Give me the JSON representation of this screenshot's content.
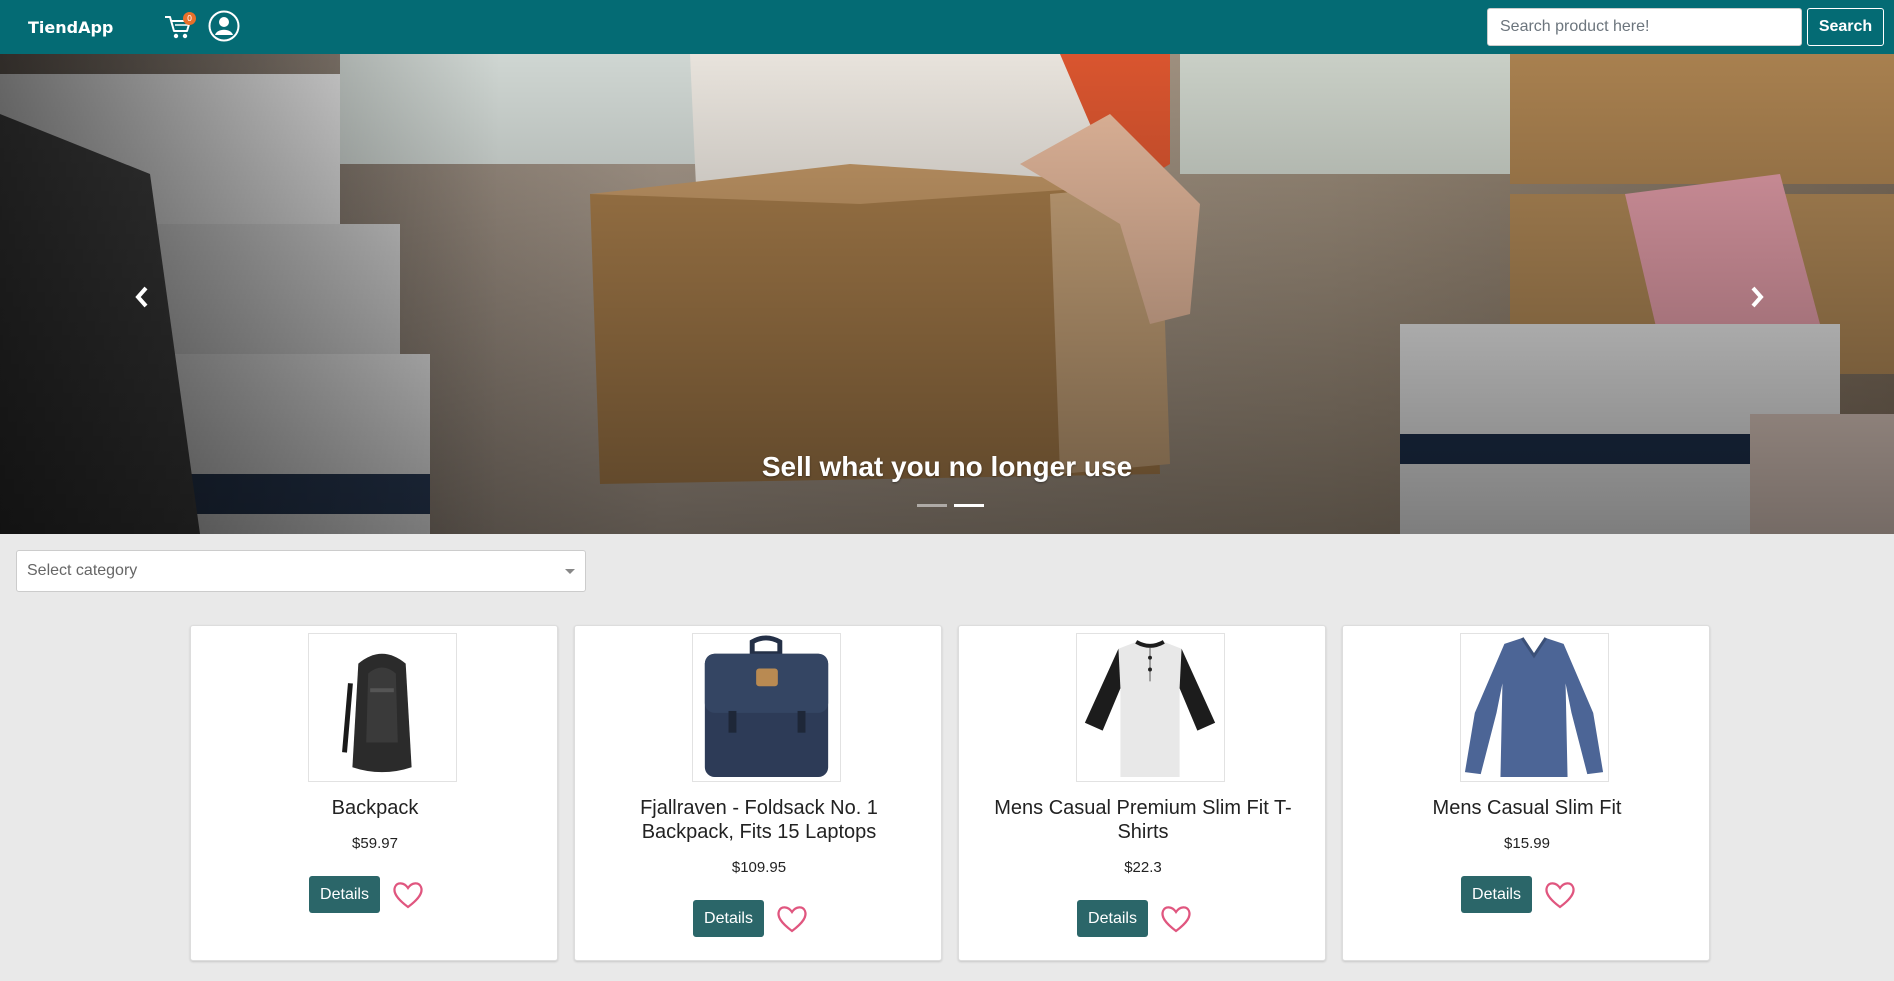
{
  "navbar": {
    "brand": "TiendApp",
    "cart_count": "0",
    "search_placeholder": "Search product here!",
    "search_button": "Search"
  },
  "hero": {
    "caption": "Sell what you no longer use",
    "slides": 2,
    "active_slide": 2
  },
  "filters": {
    "category_placeholder": "Select category"
  },
  "products": [
    {
      "title": "Backpack",
      "price": "$59.97",
      "details_label": "Details"
    },
    {
      "title": "Fjallraven - Foldsack No. 1 Backpack, Fits 15 Laptops",
      "price": "$109.95",
      "details_label": "Details"
    },
    {
      "title": "Mens Casual Premium Slim Fit T-Shirts",
      "price": "$22.3",
      "details_label": "Details"
    },
    {
      "title": "Mens Casual Slim Fit",
      "price": "$15.99",
      "details_label": "Details"
    }
  ],
  "colors": {
    "navbar": "#046b74",
    "button": "#2b6669",
    "heart": "#e0567f",
    "badge": "#e8702a"
  }
}
